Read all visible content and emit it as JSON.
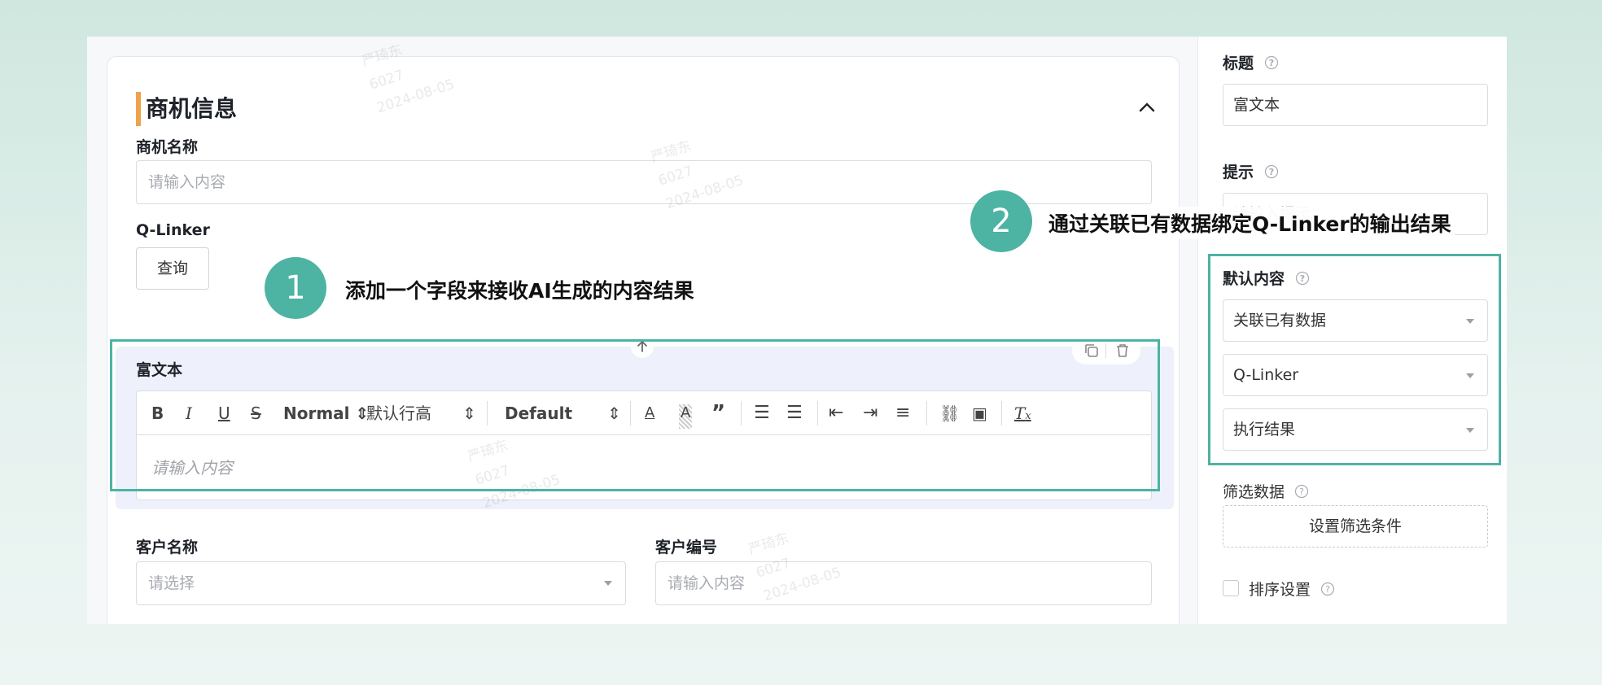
{
  "form": {
    "section_title": "商机信息",
    "opportunity_name": {
      "label": "商机名称",
      "placeholder": "请输入内容"
    },
    "qlinker": {
      "label": "Q-Linker",
      "button": "查询"
    },
    "rich_text": {
      "label": "富文本",
      "toolbar": {
        "header_select": "Normal",
        "line_height_select": "默认行高",
        "font_select": "Default"
      },
      "placeholder": "请输入内容"
    },
    "customer_name": {
      "label": "客户名称",
      "placeholder": "请选择"
    },
    "customer_number": {
      "label": "客户编号",
      "placeholder": "请输入内容"
    }
  },
  "annotations": {
    "step1": {
      "number": "1",
      "text": "添加一个字段来接收AI生成的内容结果"
    },
    "step2": {
      "number": "2",
      "text": "通过关联已有数据绑定Q-Linker的输出结果"
    }
  },
  "side_panel": {
    "title": {
      "label": "标题",
      "value": "富文本"
    },
    "hint": {
      "label": "提示",
      "value_partial": "请输入提示"
    },
    "default_content": {
      "label": "默认内容",
      "source_select": "关联已有数据",
      "form_select": "Q-Linker",
      "field_select": "执行结果"
    },
    "filter_data": {
      "label": "筛选数据",
      "button": "设置筛选条件"
    },
    "sort_settings": {
      "label": "排序设置",
      "checked": false
    }
  },
  "watermark": {
    "name": "严琦东",
    "id": "6027",
    "date": "2024-08-05"
  },
  "colors": {
    "accent": "#4db3a3",
    "section_bar": "#f0a24a"
  },
  "icons": {
    "collapse": "chevron-up-icon",
    "help": "question-circle-icon",
    "move_up": "arrow-up-icon",
    "copy": "copy-icon",
    "delete": "trash-icon"
  }
}
